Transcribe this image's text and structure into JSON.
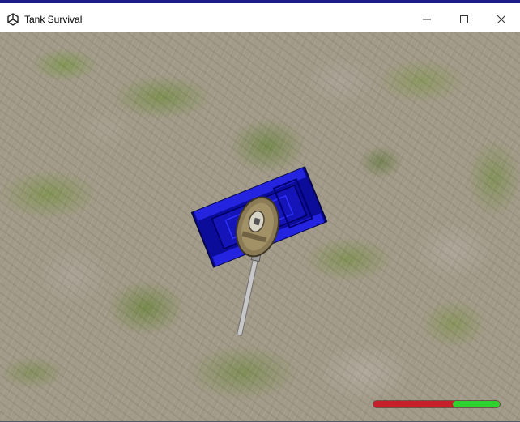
{
  "window": {
    "title": "Tank Survival",
    "app_icon": "unity-icon",
    "controls": [
      "minimize-icon",
      "maximize-icon",
      "close-icon"
    ]
  },
  "game": {
    "player_tank": {
      "hull_color": "#1010cc",
      "turret_color": "#8a7a55"
    },
    "health": {
      "fraction": 0.37,
      "fill_color": "#2fd12f",
      "empty_color": "#c8202a"
    }
  }
}
